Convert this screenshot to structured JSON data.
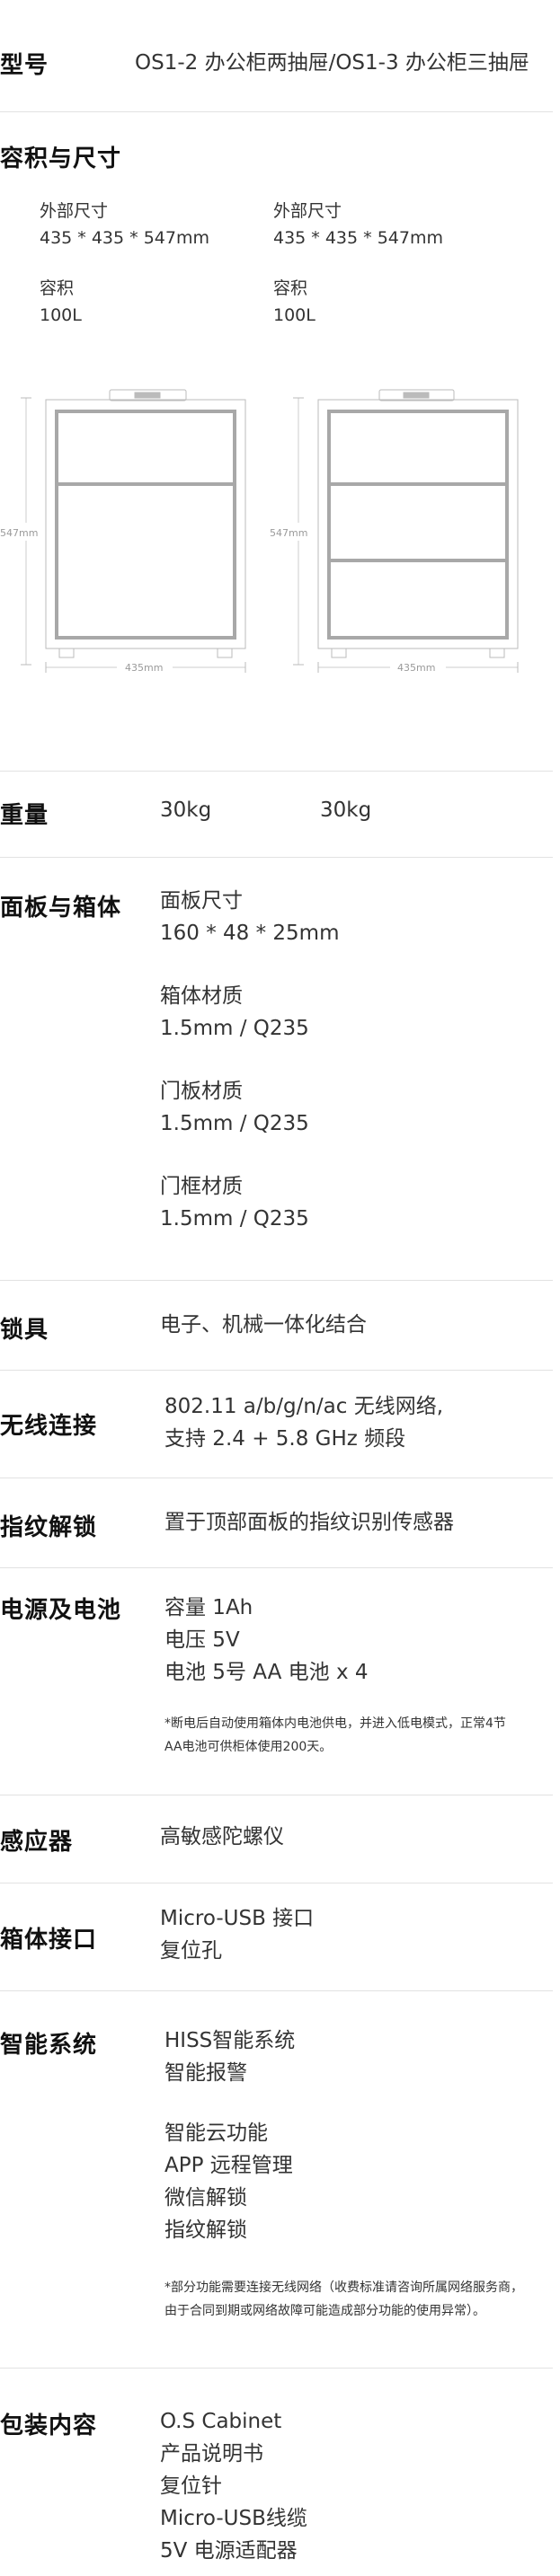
{
  "model": {
    "label": "型号",
    "value": "OS1-2 办公柜两抽屉/OS1-3 办公柜三抽屉"
  },
  "dimensions": {
    "title": "容积与尺寸",
    "col1": {
      "ext_label": "外部尺寸",
      "ext_value": "435 * 435 * 547mm",
      "vol_label": "容积",
      "vol_value": "100L"
    },
    "col2": {
      "ext_label": "外部尺寸",
      "ext_value": "435 * 435 * 547mm",
      "vol_label": "容积",
      "vol_value": "100L"
    },
    "drawing1": {
      "height_label": "547mm",
      "width_label": "435mm"
    },
    "drawing2": {
      "height_label": "547mm",
      "width_label": "435mm"
    }
  },
  "weight": {
    "label": "重量",
    "value1": "30kg",
    "value2": "30kg"
  },
  "panel": {
    "label": "面板与箱体",
    "items": [
      {
        "name": "面板尺寸",
        "value": "160 * 48 * 25mm"
      },
      {
        "name": "箱体材质",
        "value": "1.5mm / Q235"
      },
      {
        "name": "门板材质",
        "value": "1.5mm / Q235"
      },
      {
        "name": "门框材质",
        "value": "1.5mm / Q235"
      }
    ]
  },
  "lock": {
    "label": "锁具",
    "value": "电子、机械一体化结合"
  },
  "wireless": {
    "label": "无线连接",
    "lines": [
      "802.11 a/b/g/n/ac 无线网络,",
      "支持 2.4 + 5.8 GHz 频段"
    ]
  },
  "fingerprint": {
    "label": "指纹解锁",
    "value": "置于顶部面板的指纹识别传感器"
  },
  "power": {
    "label": "电源及电池",
    "lines": [
      "容量  1Ah",
      "电压  5V",
      "电池  5号 AA 电池 x 4"
    ],
    "note_lines": [
      "*断电后自动使用箱体内电池供电，并进入低电模式，正常4节",
      "AA电池可供柜体使用200天。"
    ]
  },
  "sensor": {
    "label": "感应器",
    "value": "高敏感陀螺仪"
  },
  "port": {
    "label": "箱体接口",
    "lines": [
      "Micro-USB 接口",
      "复位孔"
    ]
  },
  "smart": {
    "label": "智能系统",
    "lines_a": [
      "HISS智能系统",
      "智能报警"
    ],
    "lines_b": [
      "智能云功能",
      "APP 远程管理",
      "微信解锁",
      "指纹解锁"
    ],
    "note_lines": [
      "*部分功能需要连接无线网络（收费标准请咨询所属网络服务商，",
      "由于合同到期或网络故障可能造成部分功能的使用异常）。"
    ]
  },
  "package": {
    "label": "包装内容",
    "lines": [
      "O.S Cabinet",
      "产品说明书",
      "复位针",
      "Micro-USB线缆",
      "5V 电源适配器"
    ]
  }
}
